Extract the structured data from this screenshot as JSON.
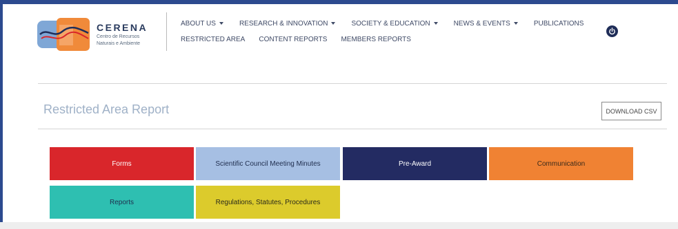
{
  "brand": {
    "name": "CERENA",
    "subtitle_line1": "Centro de Recursos",
    "subtitle_line2": "Naturais e Ambiente"
  },
  "nav": {
    "row1": [
      {
        "label": "ABOUT US",
        "dropdown": true
      },
      {
        "label": "RESEARCH & INNOVATION",
        "dropdown": true
      },
      {
        "label": "SOCIETY & EDUCATION",
        "dropdown": true
      },
      {
        "label": "NEWS & EVENTS",
        "dropdown": true
      },
      {
        "label": "PUBLICATIONS",
        "dropdown": false
      }
    ],
    "row2": [
      {
        "label": "RESTRICTED AREA"
      },
      {
        "label": "CONTENT REPORTS"
      },
      {
        "label": "MEMBERS REPORTS"
      }
    ],
    "power_icon": "power-icon"
  },
  "page": {
    "title": "Restricted Area Report",
    "download_label": "DOWNLOAD CSV"
  },
  "tiles": [
    {
      "label": "Forms",
      "color": "#d9262b",
      "text_color": "#ffffff"
    },
    {
      "label": "Scientific Council Meeting Minutes",
      "color": "#a6bfe3",
      "text_color": "#1f2d4d"
    },
    {
      "label": "Pre-Award",
      "color": "#232b62",
      "text_color": "#ffffff"
    },
    {
      "label": "Communication",
      "color": "#f08233",
      "text_color": "#3a2a1a"
    },
    {
      "label": "Reports",
      "color": "#2ebfb1",
      "text_color": "#1f2d4d"
    },
    {
      "label": "Regulations, Statutes, Procedures",
      "color": "#dccb2c",
      "text_color": "#2a2a1a"
    }
  ],
  "colors": {
    "frame_accent": "#2c4a8f",
    "nav_text": "#3f4a66",
    "title_text": "#9fb1c7",
    "power_button": "#1f2d58"
  }
}
